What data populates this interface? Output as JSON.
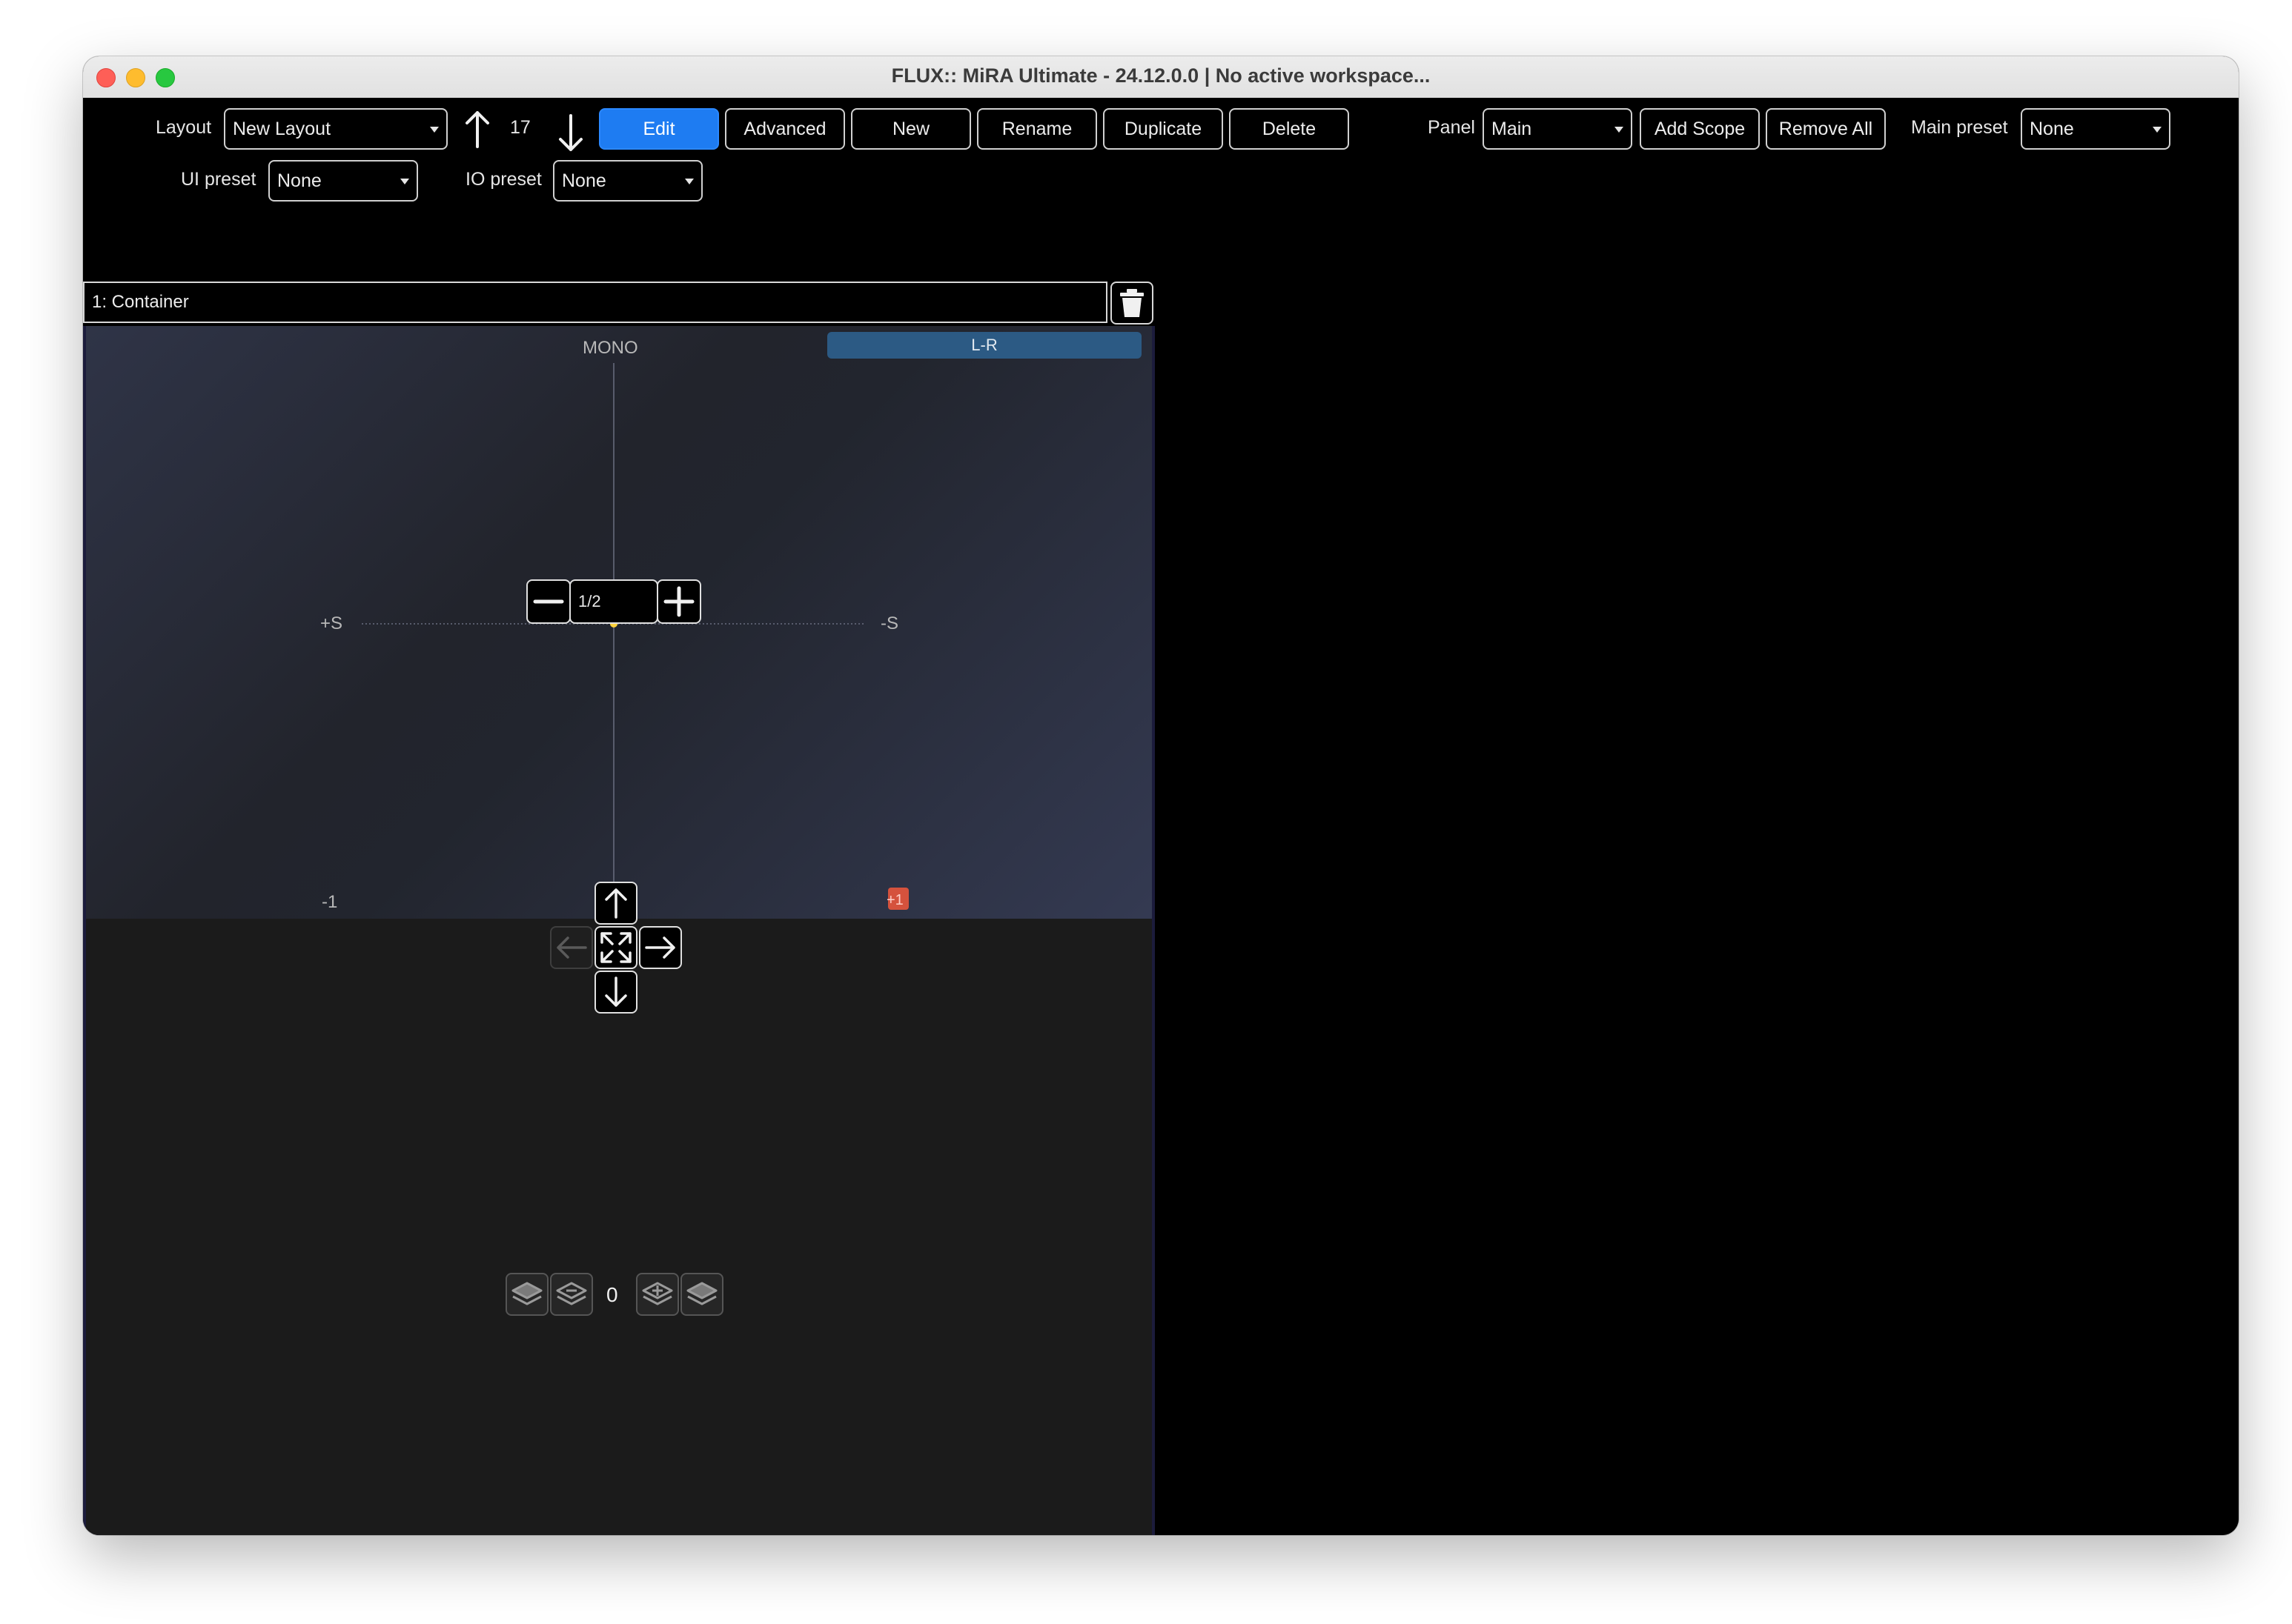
{
  "window": {
    "title": "FLUX:: MiRA Ultimate - 24.12.0.0 | No active workspace..."
  },
  "toolbar": {
    "layout_label": "Layout",
    "layout_value": "New Layout",
    "layout_index": "17",
    "edit_label": "Edit",
    "advanced_label": "Advanced",
    "new_label": "New",
    "rename_label": "Rename",
    "duplicate_label": "Duplicate",
    "delete_label": "Delete",
    "panel_label": "Panel",
    "panel_value": "Main",
    "add_scope_label": "Add Scope",
    "remove_all_label": "Remove All",
    "main_preset_label": "Main preset",
    "main_preset_value": "None",
    "ui_preset_label": "UI preset",
    "ui_preset_value": "None",
    "io_preset_label": "IO preset",
    "io_preset_value": "None"
  },
  "container": {
    "title": "1: Container"
  },
  "scope": {
    "top_label": "MONO",
    "mode_badge": "L-R",
    "left_label": "+S",
    "right_label": "-S",
    "bottom_left_label": "-1",
    "bottom_right_label": "+1",
    "zoom_value": "1/2",
    "layer_count": "0"
  },
  "colors": {
    "accent": "#1e7cf2",
    "badge": "#2c5a84",
    "marker_bottom": "#e8553c",
    "marker_center": "#ffd23c"
  },
  "icons": [
    "arrow-up-icon",
    "arrow-down-icon",
    "arrow-left-icon",
    "arrow-right-icon",
    "fullscreen-icon",
    "minus-icon",
    "plus-icon",
    "trash-icon",
    "layer-icon",
    "layer-add-icon"
  ]
}
